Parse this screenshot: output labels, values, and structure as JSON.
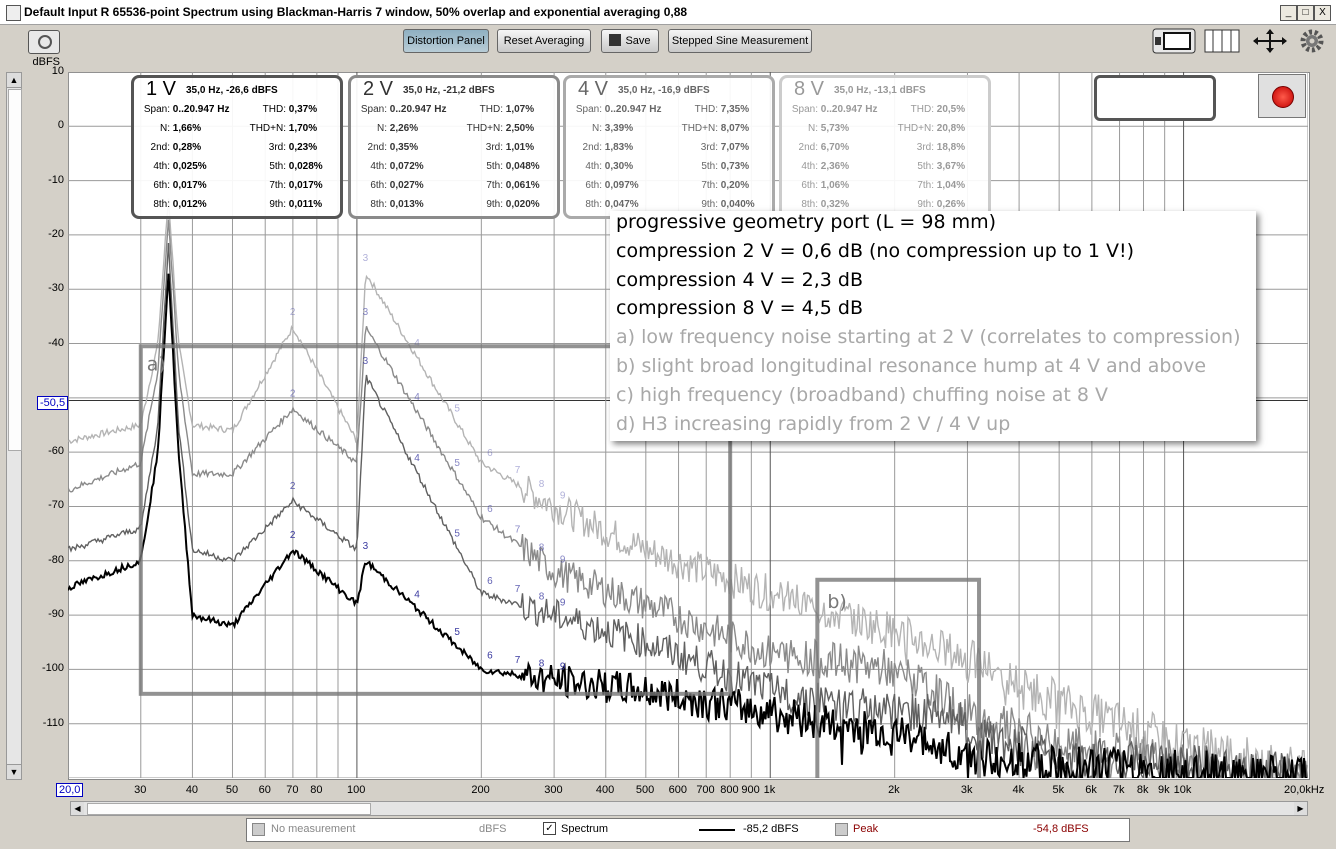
{
  "window": {
    "title": "Default Input R 65536-point Spectrum using Blackman-Harris 7 window, 50% overlap and exponential averaging 0,88",
    "minimize": "_",
    "maximize": "□",
    "close": "X"
  },
  "toolbar": {
    "distortion_panel": "Distortion Panel",
    "reset_averaging": "Reset Averaging",
    "save": "Save",
    "stepped_sine": "Stepped Sine Measurement"
  },
  "axes": {
    "y_unit": "dBFS",
    "y_ticks": [
      "10",
      "0",
      "-10",
      "-20",
      "-30",
      "-40",
      "-60",
      "-70",
      "-80",
      "-90",
      "-100",
      "-110"
    ],
    "y_marker": "-50,5",
    "x_start": "20,0",
    "x_ticks": [
      "30",
      "40",
      "50",
      "60",
      "70",
      "80",
      "100",
      "200",
      "300",
      "400",
      "500",
      "600",
      "700",
      "800",
      "900",
      "1k",
      "2k",
      "3k",
      "4k",
      "5k",
      "6k",
      "7k",
      "8k",
      "9k",
      "10k"
    ],
    "x_end": "20,0kHz"
  },
  "panels": [
    {
      "level": "1 V",
      "header": "35,0 Hz, -26,6 dBFS",
      "color": "#555555",
      "textcolor": "#000000",
      "rows": [
        [
          "Span:",
          "0..20.947 Hz",
          "THD:",
          "0,37%"
        ],
        [
          "N:",
          "1,66%",
          "THD+N:",
          "1,70%"
        ],
        [
          "2nd:",
          "0,28%",
          "3rd:",
          "0,23%"
        ],
        [
          "4th:",
          "0,025%",
          "5th:",
          "0,028%"
        ],
        [
          "6th:",
          "0,017%",
          "7th:",
          "0,017%"
        ],
        [
          "8th:",
          "0,012%",
          "9th:",
          "0,011%"
        ]
      ]
    },
    {
      "level": "2 V",
      "header": "35,0 Hz, -21,2 dBFS",
      "color": "#8a8a8a",
      "textcolor": "#333333",
      "rows": [
        [
          "Span:",
          "0..20.947 Hz",
          "THD:",
          "1,07%"
        ],
        [
          "N:",
          "2,26%",
          "THD+N:",
          "2,50%"
        ],
        [
          "2nd:",
          "0,35%",
          "3rd:",
          "1,01%"
        ],
        [
          "4th:",
          "0,072%",
          "5th:",
          "0,048%"
        ],
        [
          "6th:",
          "0,027%",
          "7th:",
          "0,061%"
        ],
        [
          "8th:",
          "0,013%",
          "9th:",
          "0,020%"
        ]
      ]
    },
    {
      "level": "4 V",
      "header": "35,0 Hz, -16,9 dBFS",
      "color": "#aaaaaa",
      "textcolor": "#666666",
      "rows": [
        [
          "Span:",
          "0..20.947 Hz",
          "THD:",
          "7,35%"
        ],
        [
          "N:",
          "3,39%",
          "THD+N:",
          "8,07%"
        ],
        [
          "2nd:",
          "1,83%",
          "3rd:",
          "7,07%"
        ],
        [
          "4th:",
          "0,30%",
          "5th:",
          "0,73%"
        ],
        [
          "6th:",
          "0,097%",
          "7th:",
          "0,20%"
        ],
        [
          "8th:",
          "0,047%",
          "9th:",
          "0,040%"
        ]
      ]
    },
    {
      "level": "8 V",
      "header": "35,0 Hz, -13,1 dBFS",
      "color": "#cccccc",
      "textcolor": "#999999",
      "rows": [
        [
          "Span:",
          "0..20.947 Hz",
          "THD:",
          "20,5%"
        ],
        [
          "N:",
          "5,73%",
          "THD+N:",
          "20,8%"
        ],
        [
          "2nd:",
          "6,70%",
          "3rd:",
          "18,8%"
        ],
        [
          "4th:",
          "2,36%",
          "5th:",
          "3,67%"
        ],
        [
          "6th:",
          "1,06%",
          "7th:",
          "1,04%"
        ],
        [
          "8th:",
          "0,32%",
          "9th:",
          "0,26%"
        ]
      ]
    }
  ],
  "annotation": {
    "lines_dark": [
      "progressive geometry port (L = 98 mm)",
      "compression 2 V = 0,6 dB (no compression up to 1 V!)",
      "compression 4 V = 2,3 dB",
      "compression 8 V = 4,5 dB"
    ],
    "lines_light": [
      "a) low frequency noise starting at 2 V (correlates to compression)",
      "b) slight broad longitudinal resonance hump at 4 V and above",
      "c) high frequency (broadband) chuffing noise at 8 V",
      "d) H3 increasing rapidly from 2 V / 4 V up"
    ],
    "box_a": "a)",
    "box_b": "b)"
  },
  "legend": {
    "no_measurement": "No measurement",
    "unit1": "dBFS",
    "spectrum": "Spectrum",
    "spectrum_value": "-85,2 dBFS",
    "peak": "Peak",
    "peak_value": "-54,8 dBFS"
  },
  "colors": {
    "trace_1v": "#000000",
    "trace_2v": "#606060",
    "trace_4v": "#8a8a8a",
    "trace_8v": "#b4b4b4",
    "harmonic_label": "#3a3aa0",
    "peak_red": "#8b0000"
  },
  "chart_data": {
    "type": "line",
    "xlabel": "",
    "ylabel": "dBFS",
    "xscale": "log",
    "xlim": [
      20,
      20000
    ],
    "ylim": [
      -120,
      10
    ],
    "series": [
      {
        "name": "1 V",
        "x": [
          20,
          30,
          33,
          35,
          37,
          40,
          50,
          70,
          100,
          105,
          200,
          300,
          500,
          1000,
          2000,
          3000,
          5000,
          10000,
          20000
        ],
        "y": [
          -85,
          -80,
          -60,
          -26.6,
          -60,
          -90,
          -92,
          -78,
          -88,
          -80,
          -100,
          -102,
          -104,
          -108,
          -112,
          -116,
          -118,
          -119,
          -120
        ]
      },
      {
        "name": "2 V",
        "x": [
          20,
          30,
          33,
          35,
          37,
          40,
          50,
          70,
          100,
          105,
          200,
          300,
          500,
          1000,
          2000,
          2800,
          3000,
          5000,
          10000,
          20000
        ],
        "y": [
          -78,
          -74,
          -55,
          -21.2,
          -55,
          -78,
          -80,
          -69,
          -78,
          -46,
          -86,
          -90,
          -95,
          -104,
          -108,
          -108,
          -112,
          -116,
          -118,
          -120
        ]
      },
      {
        "name": "4 V",
        "x": [
          20,
          30,
          33,
          35,
          37,
          40,
          50,
          70,
          100,
          105,
          200,
          300,
          500,
          1000,
          2000,
          3000,
          5000,
          10000,
          20000
        ],
        "y": [
          -67,
          -62,
          -45,
          -16.9,
          -45,
          -64,
          -64,
          -52,
          -62,
          -37,
          -72,
          -82,
          -88,
          -97,
          -100,
          -108,
          -114,
          -117,
          -120
        ]
      },
      {
        "name": "8 V",
        "x": [
          20,
          30,
          33,
          35,
          37,
          40,
          50,
          70,
          100,
          105,
          200,
          300,
          500,
          1000,
          2000,
          3000,
          5000,
          10000,
          20000
        ],
        "y": [
          -58,
          -55,
          -40,
          -13.1,
          -40,
          -55,
          -56,
          -37,
          -58,
          -27,
          -62,
          -70,
          -78,
          -86,
          -93,
          -98,
          -106,
          -114,
          -119
        ]
      }
    ]
  }
}
